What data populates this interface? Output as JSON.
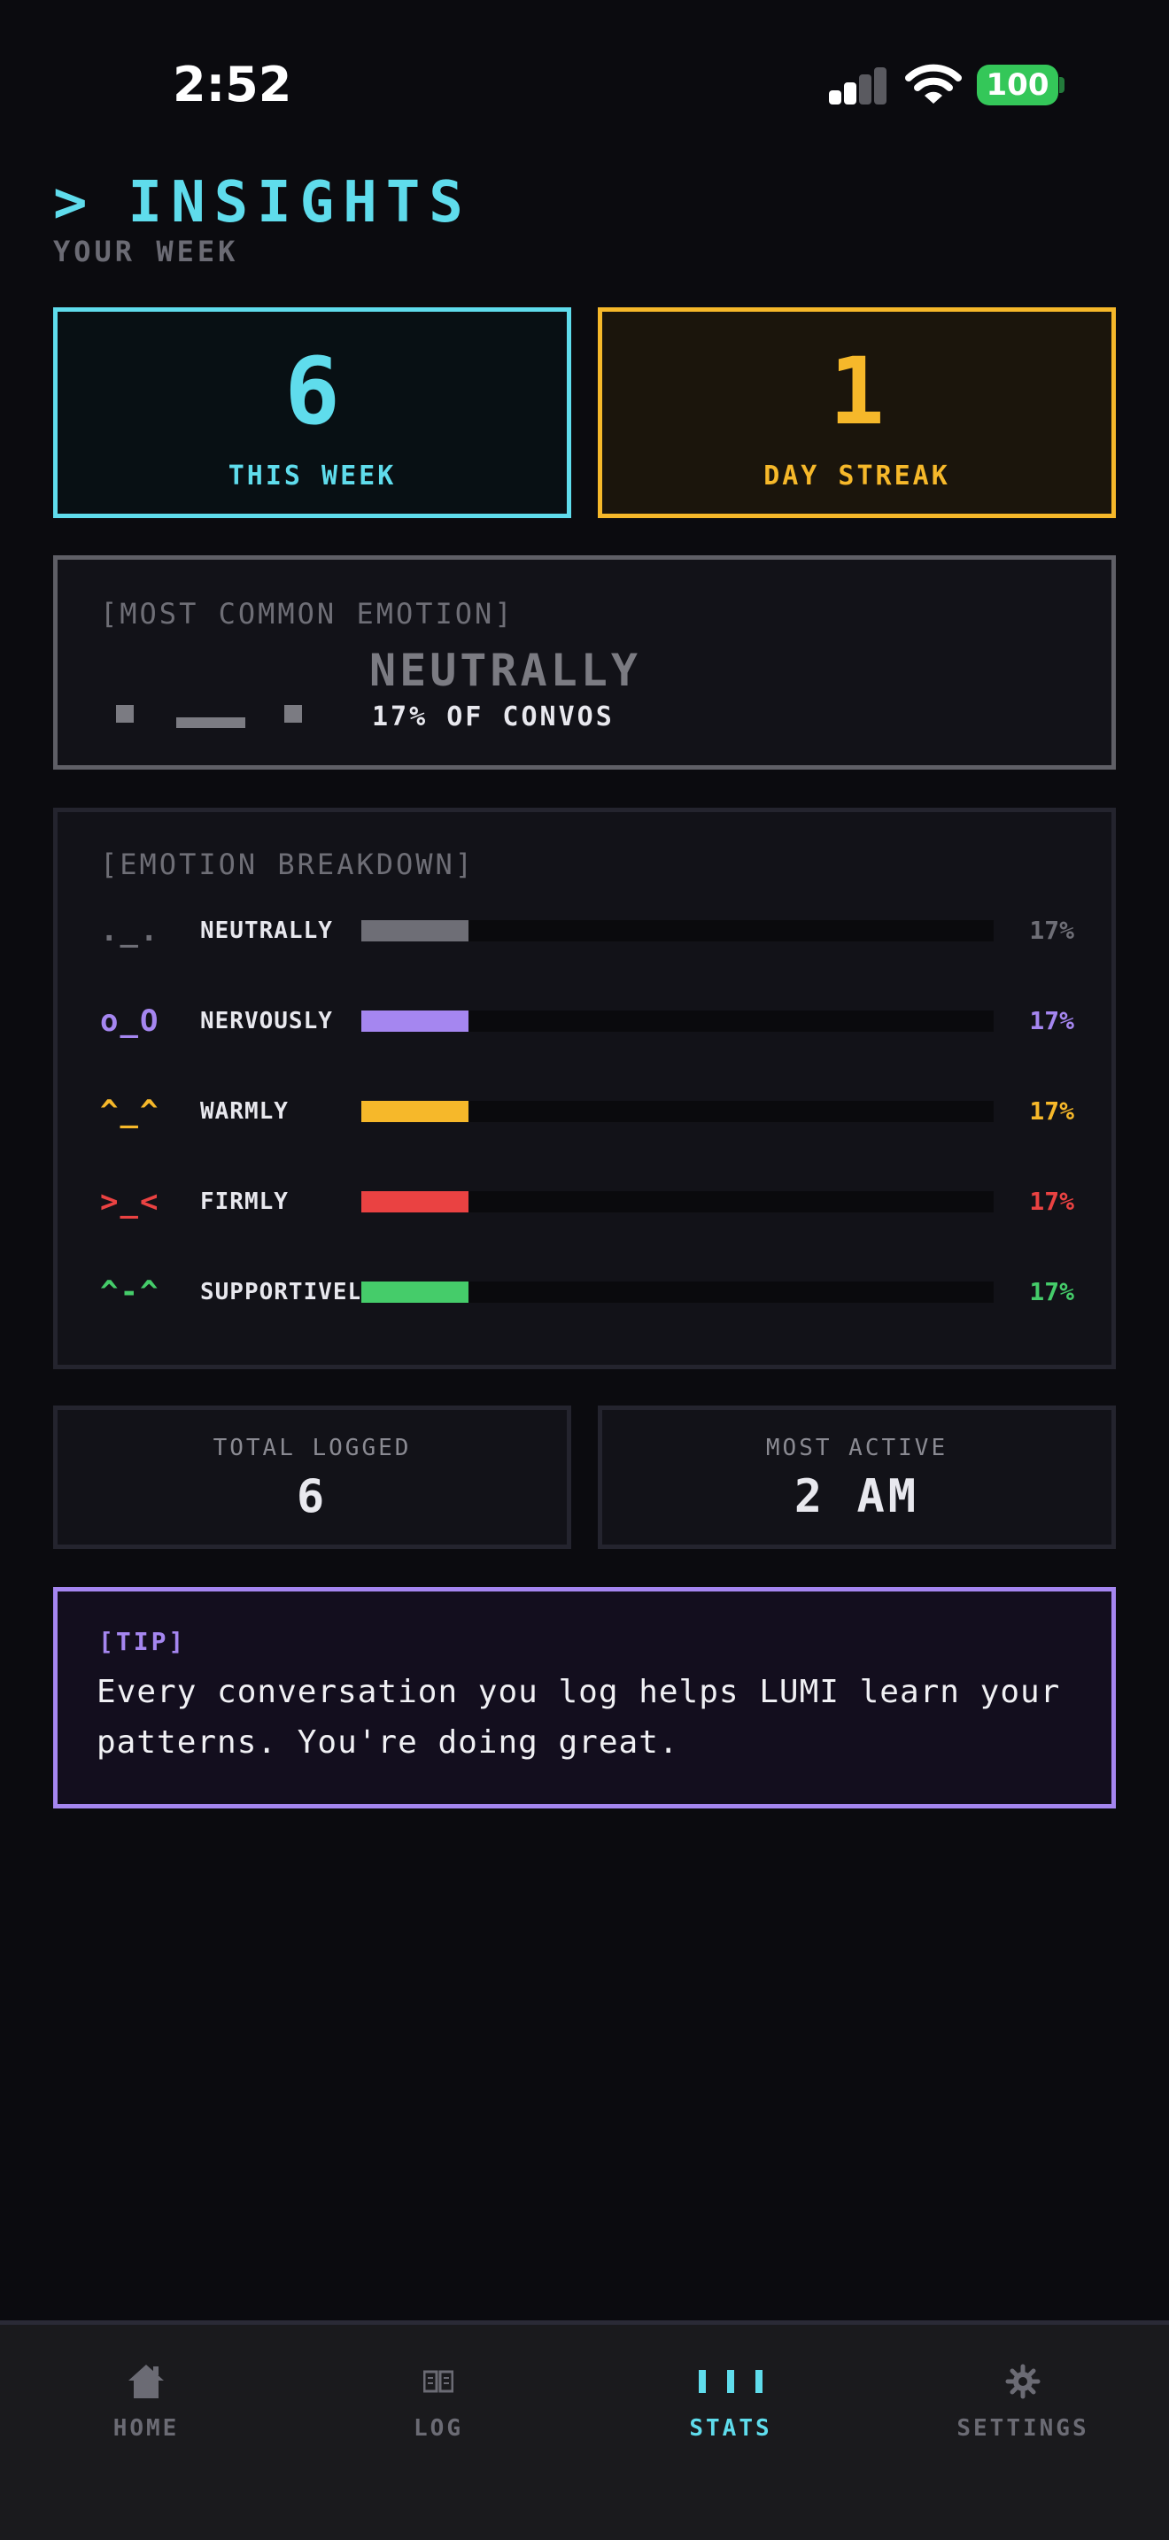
{
  "status_bar": {
    "time": "2:52",
    "battery": "100"
  },
  "header": {
    "prompt": ">",
    "title": "INSIGHTS",
    "subtitle": "YOUR WEEK"
  },
  "stats": {
    "this_week": {
      "value": "6",
      "label": "THIS WEEK"
    },
    "streak": {
      "value": "1",
      "label": "DAY STREAK"
    }
  },
  "most_common": {
    "label": "[MOST COMMON EMOTION]",
    "emotion": "NEUTRALLY",
    "percent_text": "17% OF CONVOS"
  },
  "breakdown": {
    "label": "[EMOTION BREAKDOWN]",
    "items": [
      {
        "face": "._.",
        "name": "NEUTRALLY",
        "percent": "17%",
        "fraction": 0.17,
        "color": "#6e6e76"
      },
      {
        "face": "o_O",
        "name": "NERVOUSLY",
        "percent": "17%",
        "fraction": 0.17,
        "color": "#a586f0"
      },
      {
        "face": "^_^",
        "name": "WARMLY",
        "percent": "17%",
        "fraction": 0.17,
        "color": "#f6b82a"
      },
      {
        "face": ">_<",
        "name": "FIRMLY",
        "percent": "17%",
        "fraction": 0.17,
        "color": "#ea4242"
      },
      {
        "face": "^-^",
        "name": "SUPPORTIVELY",
        "percent": "17%",
        "fraction": 0.17,
        "color": "#45cc6a"
      }
    ]
  },
  "totals": {
    "total_logged": {
      "label": "TOTAL LOGGED",
      "value": "6"
    },
    "most_active": {
      "label": "MOST ACTIVE",
      "value": "2 AM"
    }
  },
  "tip": {
    "label": "[TIP]",
    "text": "Every conversation you log helps LUMI learn your patterns. You're doing great."
  },
  "tabs": [
    {
      "label": "HOME",
      "icon": "home-icon"
    },
    {
      "label": "LOG",
      "icon": "book-icon"
    },
    {
      "label": "STATS",
      "icon": "stats-icon",
      "active": true
    },
    {
      "label": "SETTINGS",
      "icon": "gear-icon"
    }
  ],
  "colors": {
    "cyan": "#5fdcec",
    "amber": "#f6b82a",
    "purple": "#a586f0",
    "background": "#0b0b0f"
  }
}
